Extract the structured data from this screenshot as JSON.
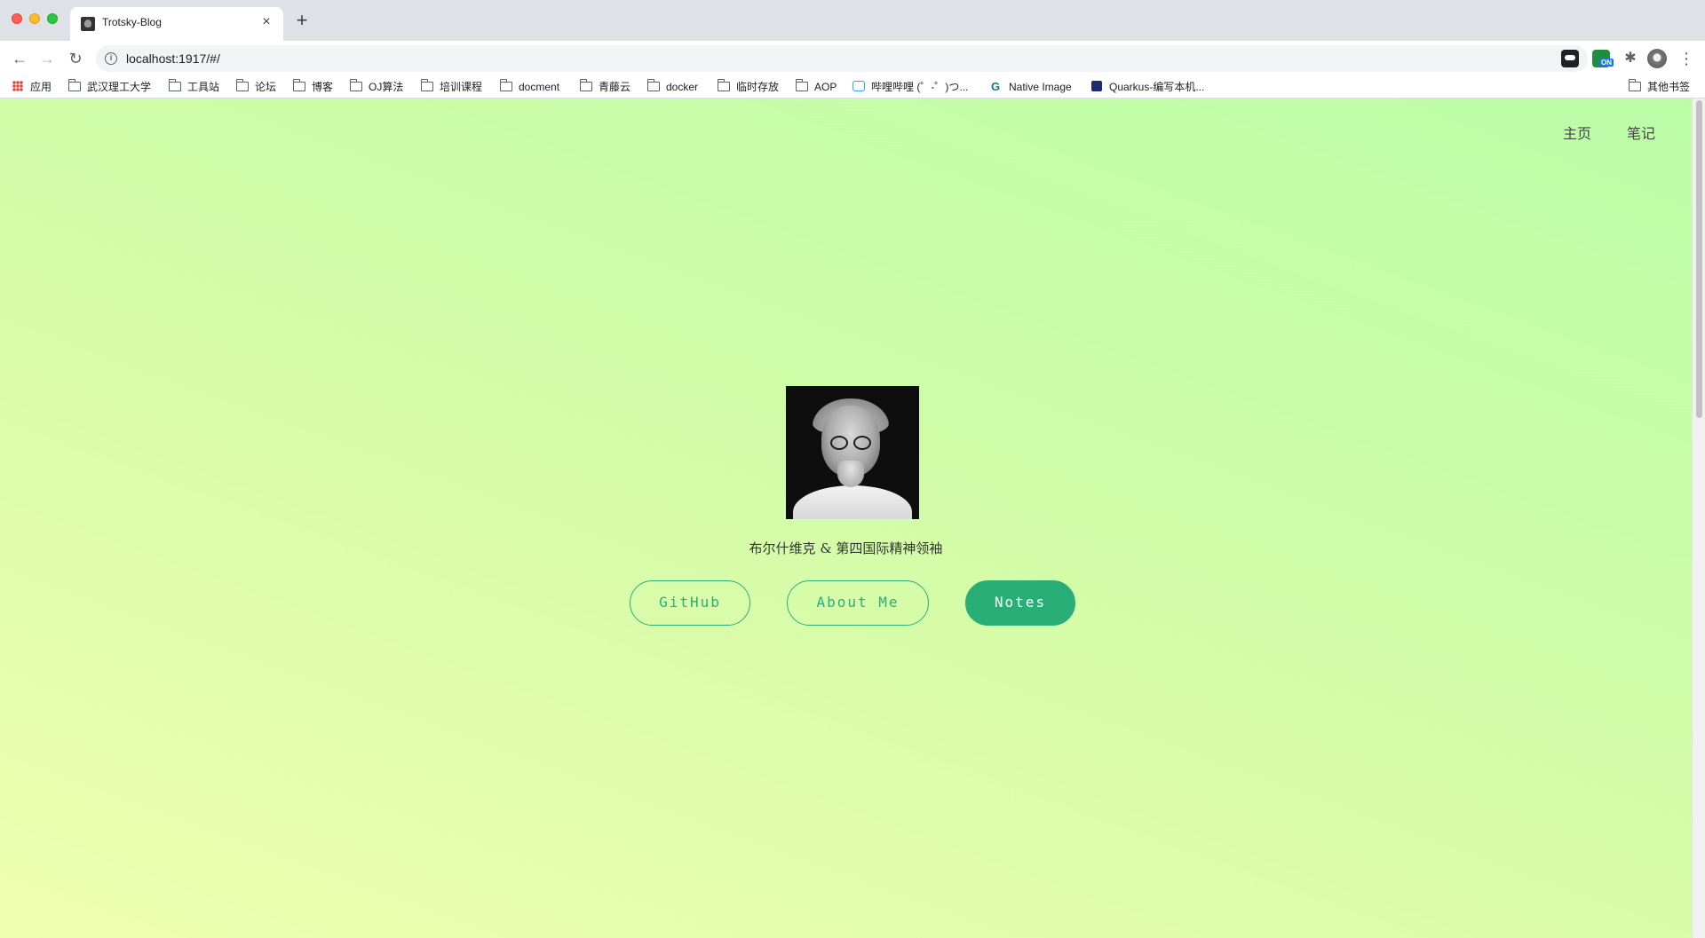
{
  "browser": {
    "tab_title": "Trotsky-Blog",
    "tab_close": "×",
    "new_tab": "+",
    "url": "localhost:1917/#/",
    "back": "←",
    "forward": "→",
    "reload": "↻",
    "info": "i",
    "star": "☆",
    "extensions_glyph": "✱",
    "menu": "⋮",
    "extension_badge": "ON"
  },
  "bookmarks": {
    "apps": "应用",
    "items": [
      "武汉理工大学",
      "工具站",
      "论坛",
      "博客",
      "OJ算法",
      "培训课程",
      "docment",
      "青藤云",
      "docker",
      "临时存放",
      "AOP"
    ],
    "bilibili": "哔哩哔哩 (゜-゜)つ...",
    "native_image": "Native Image",
    "quarkus": "Quarkus-编写本机...",
    "other": "其他书签"
  },
  "site": {
    "nav_home": "主页",
    "nav_notes": "笔记",
    "tagline": "布尔什维克 & 第四国际精神领袖",
    "buttons": {
      "github": "GitHub",
      "about": "About Me",
      "notes": "Notes"
    }
  },
  "colors": {
    "accent": "#2aae77",
    "background_start": "#f0ffb0",
    "background_end": "#bbfda7"
  }
}
